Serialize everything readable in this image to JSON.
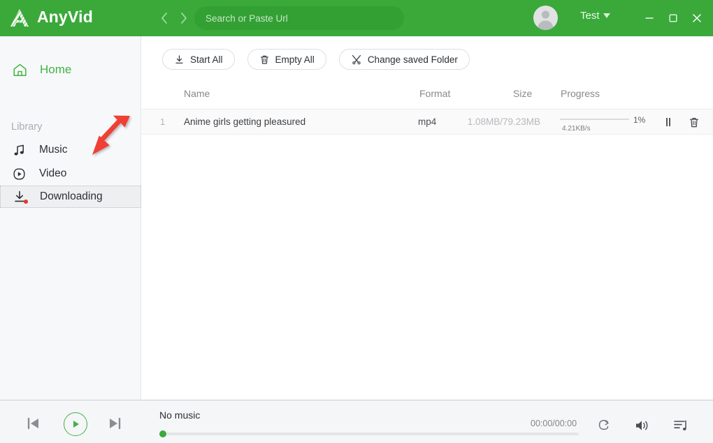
{
  "header": {
    "brand": "AnyVid",
    "logo_icon": "anyvid-logo-icon",
    "back_icon": "chevron-left-icon",
    "forward_icon": "chevron-right-icon",
    "search": {
      "placeholder": "Search or Paste Url",
      "value": "",
      "icon": "search-icon"
    },
    "avatar_icon": "user-avatar-icon",
    "account_name": "Test",
    "account_caret_icon": "caret-down-icon",
    "window_controls": {
      "minimize_icon": "minimize-icon",
      "maximize_icon": "maximize-icon",
      "close_icon": "close-icon"
    },
    "bg_color": "#3aa93a"
  },
  "sidebar": {
    "home": {
      "label": "Home",
      "icon": "home-icon",
      "color": "#41b241"
    },
    "library_label": "Library",
    "items": [
      {
        "label": "Music",
        "icon": "music-note-icon",
        "selected": false
      },
      {
        "label": "Video",
        "icon": "video-play-circle-icon",
        "selected": false
      },
      {
        "label": "Downloading",
        "icon": "download-icon",
        "selected": true,
        "badge": true
      }
    ]
  },
  "toolbar": {
    "buttons": [
      {
        "label": "Start All",
        "icon": "download-arrow-icon"
      },
      {
        "label": "Empty All",
        "icon": "trash-icon"
      },
      {
        "label": "Change saved Folder",
        "icon": "wrench-tools-icon"
      }
    ]
  },
  "table": {
    "columns": [
      "Name",
      "Format",
      "Size",
      "Progress"
    ],
    "rows": [
      {
        "index": "1",
        "name": "Anime girls getting pleasured",
        "format": "mp4",
        "size": "1.08MB/79.23MB",
        "progress_percent": 1,
        "progress_label": "1%",
        "speed": "4.21KB/s",
        "pause_icon": "pause-icon",
        "delete_icon": "trash-icon"
      }
    ]
  },
  "player": {
    "prev_icon": "skip-previous-icon",
    "play_icon": "play-icon",
    "next_icon": "skip-next-icon",
    "track_title": "No music",
    "time": "00:00/00:00",
    "seek_percent": 0,
    "repeat_icon": "repeat-icon",
    "volume_icon": "volume-icon",
    "queue_icon": "playlist-queue-icon",
    "accent_color": "#3aa93a"
  },
  "annotation": {
    "arrow_icon": "red-arrow-icon",
    "color": "#ef4136"
  }
}
